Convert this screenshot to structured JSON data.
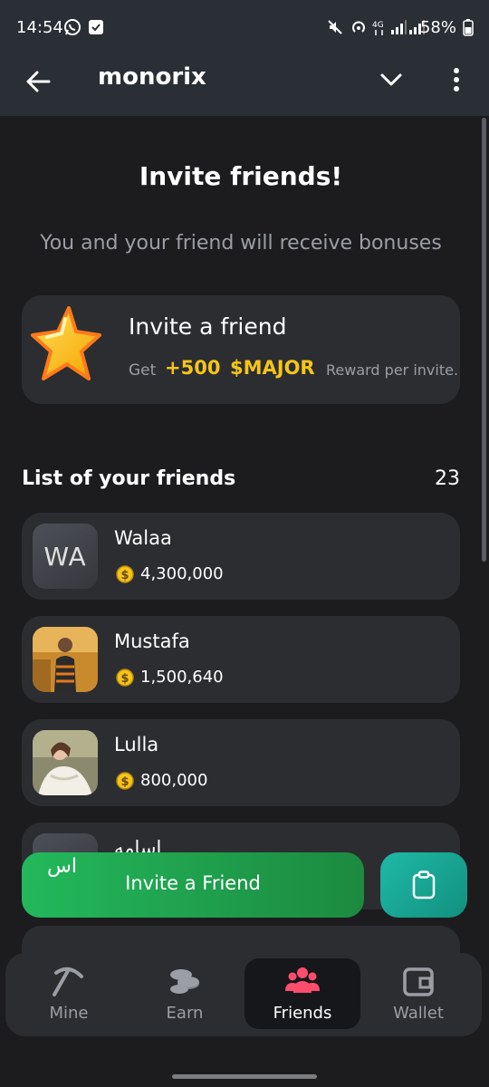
{
  "status_bar": {
    "time": "14:54",
    "battery": "58%"
  },
  "app_bar": {
    "title": "monorix"
  },
  "page": {
    "title": "Invite friends!",
    "subtitle": "You and your friend will receive bonuses"
  },
  "invite_card": {
    "title": "Invite a friend",
    "get": "Get",
    "amount": "+500",
    "currency": "$MAJOR",
    "reward_text": "Reward per invite."
  },
  "friends": {
    "title": "List of your friends",
    "count": "23",
    "items": [
      {
        "name": "Walaa",
        "initials": "WA",
        "balance": "4,300,000"
      },
      {
        "name": "Mustafa",
        "balance": "1,500,640"
      },
      {
        "name": "Lulla",
        "balance": "800,000"
      },
      {
        "name": "اسامه"
      }
    ]
  },
  "overlap_text": "اس",
  "invite_button": {
    "label": "Invite a Friend"
  },
  "nav": {
    "items": [
      {
        "label": "Mine",
        "icon": "pickaxe-icon"
      },
      {
        "label": "Earn",
        "icon": "coins-icon"
      },
      {
        "label": "Friends",
        "icon": "friends-icon",
        "active": true
      },
      {
        "label": "Wallet",
        "icon": "wallet-icon"
      }
    ]
  },
  "colors": {
    "background": "#1c1c1f",
    "card": "#2b2d31",
    "header": "#2a2e35",
    "accent_yellow": "#f5c518",
    "invite_green": "#23b85c",
    "copy_teal": "#1fb9a6",
    "friends_icon_red": "#ff4d6d"
  }
}
